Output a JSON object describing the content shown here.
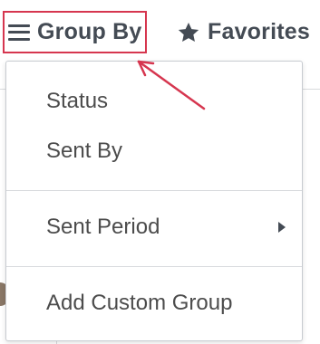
{
  "toolbar": {
    "group_by_label": "Group By",
    "favorites_label": "Favorites",
    "group_by_icon": "hamburger-icon",
    "favorites_icon": "star-icon",
    "highlight_color": "#d6364f"
  },
  "group_by_menu": {
    "items": [
      {
        "label": "Status"
      },
      {
        "label": "Sent By"
      },
      {
        "label": "Sent Period",
        "submenu_icon": "caret-right-icon"
      },
      {
        "label": "Add Custom Group"
      }
    ]
  }
}
